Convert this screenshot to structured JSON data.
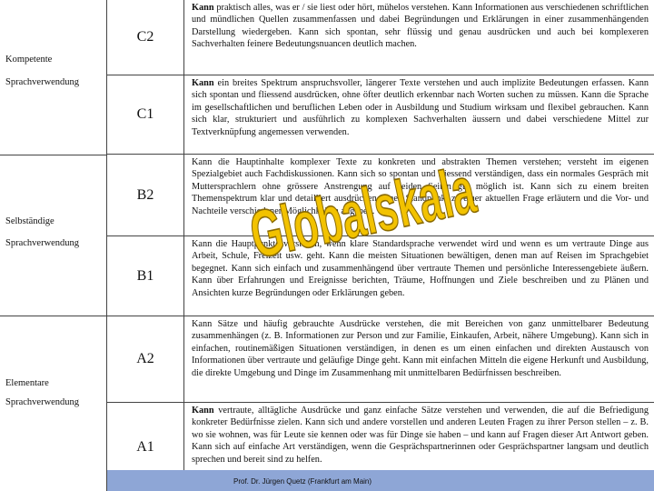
{
  "categories": [
    "Kompetente",
    "Sprachverwendung",
    "Selbständige",
    "Sprachverwendung",
    "Elementare",
    "Sprachverwendung"
  ],
  "levels": [
    {
      "code": "C2",
      "desc_lead": "Kann",
      "desc": " praktisch alles, was er / sie liest oder hört, mühelos verstehen. Kann Informationen aus verschiedenen schriftlichen und mündlichen Quellen zusammenfassen und dabei Begründungen und Erklärungen in einer zusammenhängenden Darstellung wiedergeben. Kann sich spontan, sehr flüssig und genau ausdrücken und auch bei komplexeren Sachverhalten feinere Bedeutungsnuancen deutlich machen."
    },
    {
      "code": "C1",
      "desc_lead": "Kann",
      "desc": " ein breites Spektrum anspruchsvoller, längerer Texte verstehen und auch implizite Bedeutungen erfassen. Kann sich spontan und fliessend ausdrücken, ohne öfter deutlich erkennbar nach Worten suchen zu müssen. Kann die Sprache im gesellschaftlichen und beruflichen Leben oder in Ausbildung und Studium wirksam und flexibel gebrauchen. Kann sich klar, strukturiert und ausführlich zu komplexen Sachverhalten äussern und dabei verschiedene Mittel zur Textverknüpfung angemessen verwenden."
    },
    {
      "code": "B2",
      "desc_lead": "",
      "desc": "Kann die Hauptinhalte komplexer Texte zu konkreten und abstrakten Themen verstehen; versteht im eigenen Spezialgebiet auch Fachdiskussionen. Kann sich so spontan und fliessend verständigen, dass ein normales Gespräch mit Muttersprachlern ohne grössere Anstrengung auf beiden Seiten gut möglich ist. Kann sich zu einem breiten Themenspektrum klar und detailliert ausdrücken, einen Standpunkt zu einer aktuellen Frage erläutern und die Vor- und Nachteile verschiedener Möglichkeiten angeben."
    },
    {
      "code": "B1",
      "desc_lead": "",
      "desc": "Kann die Hauptpunkte verstehen, wenn klare Standardsprache verwendet wird und wenn es um vertraute Dinge aus Arbeit, Schule, Freizeit usw. geht. Kann die meisten Situationen bewältigen, denen man auf Reisen im Sprachgebiet begegnet. Kann sich einfach und zusammenhängend über vertraute Themen und persönliche Interessengebiete äußern. Kann über Erfahrungen und Ereignisse berichten, Träume, Hoffnungen und Ziele beschreiben und zu Plänen und Ansichten kurze Begründungen oder Erklärungen geben."
    },
    {
      "code": "A2",
      "desc_lead": "",
      "desc": "Kann Sätze und häufig gebrauchte Ausdrücke verstehen, die mit Bereichen von ganz unmittelbarer Bedeutung zusammenhängen (z. B. Informationen zur Person und zur Familie, Einkaufen, Arbeit, nähere Umgebung). Kann sich in einfachen, routinemäßigen Situationen verständigen, in denen es um einen einfachen und direkten Austausch von Informationen über vertraute und geläufige Dinge geht. Kann mit einfachen Mitteln die eigene Herkunft und Ausbildung, die direkte Umgebung und Dinge im Zusammenhang mit unmittelbaren Bedürfnissen beschreiben."
    },
    {
      "code": "A1",
      "desc_lead": "Kann",
      "desc": " vertraute, alltägliche Ausdrücke und ganz einfache Sätze verstehen und verwenden, die auf die Befriedigung konkreter Bedürfnisse zielen. Kann sich und andere vorstellen und anderen Leuten Fragen zu ihrer Person stellen – z. B. wo sie wohnen, was für Leute sie kennen oder was für Dinge sie haben – und kann auf Fragen dieser Art Antwort geben. Kann sich auf einfache Art verständigen, wenn die Gesprächspartnerinnen oder Gesprächspartner langsam und deutlich sprechen und bereit sind zu helfen."
    }
  ],
  "overlay_title": "Globalskala",
  "footer": "Prof. Dr. Jürgen Quetz (Frankfurt am Main)",
  "colors": {
    "overlay_fill": "#f2c200",
    "overlay_stroke": "#8a6a00",
    "footer_band": "#8ea6d6"
  }
}
